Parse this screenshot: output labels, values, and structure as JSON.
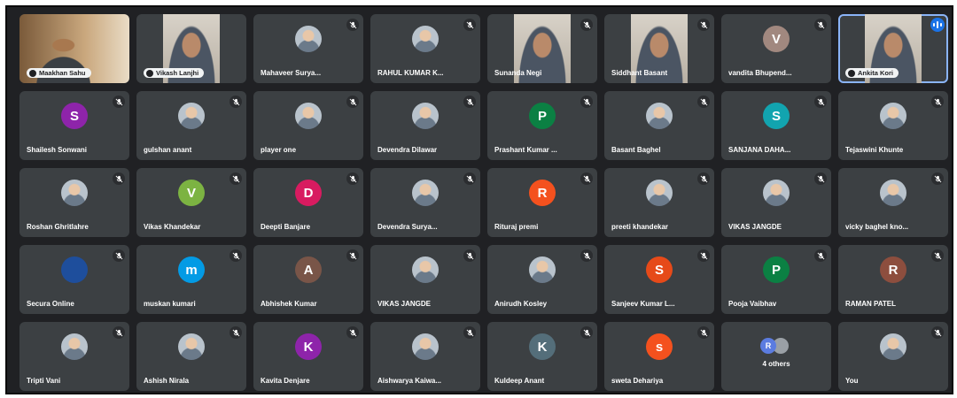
{
  "participants": [
    {
      "name": "Maakhan Sahu",
      "type": "video_wide",
      "muted": false,
      "pill": true
    },
    {
      "name": "Vikash Lanjhi",
      "type": "video",
      "muted": false,
      "pill": true
    },
    {
      "name": "Mahaveer Surya...",
      "type": "photo",
      "muted": true
    },
    {
      "name": "RAHUL KUMAR K...",
      "type": "photo",
      "muted": true
    },
    {
      "name": "Sunanda Negi",
      "type": "video",
      "muted": true
    },
    {
      "name": "Siddhant Basant",
      "type": "video",
      "muted": true
    },
    {
      "name": "vandita Bhupend...",
      "type": "letter",
      "letter": "V",
      "color": "#a1887f",
      "muted": true
    },
    {
      "name": "Ankita Kori",
      "type": "video",
      "muted": false,
      "pill": true,
      "speaking": true
    },
    {
      "name": "Shailesh Sonwani",
      "type": "letter",
      "letter": "S",
      "color": "#8e24aa",
      "muted": true
    },
    {
      "name": "gulshan anant",
      "type": "photo",
      "muted": true
    },
    {
      "name": "player one",
      "type": "photo",
      "muted": true
    },
    {
      "name": "Devendra Dilawar",
      "type": "photo",
      "muted": true
    },
    {
      "name": "Prashant Kumar ...",
      "type": "letter",
      "letter": "P",
      "color": "#0b8043",
      "muted": true
    },
    {
      "name": "Basant Baghel",
      "type": "photo",
      "muted": true
    },
    {
      "name": "SANJANA DAHA...",
      "type": "letter",
      "letter": "S",
      "color": "#12a4af",
      "muted": true
    },
    {
      "name": "Tejaswini Khunte",
      "type": "photo",
      "muted": true
    },
    {
      "name": "Roshan Ghritlahre",
      "type": "photo",
      "muted": true
    },
    {
      "name": "Vikas Khandekar",
      "type": "letter",
      "letter": "V",
      "color": "#7cb342",
      "muted": true
    },
    {
      "name": "Deepti Banjare",
      "type": "letter",
      "letter": "D",
      "color": "#d81b60",
      "muted": true
    },
    {
      "name": "Devendra Surya...",
      "type": "photo",
      "muted": true
    },
    {
      "name": "Rituraj premi",
      "type": "letter",
      "letter": "R",
      "color": "#f4511e",
      "muted": true
    },
    {
      "name": "preeti khandekar",
      "type": "photo",
      "muted": true
    },
    {
      "name": "VIKAS JANGDE",
      "type": "photo",
      "muted": true
    },
    {
      "name": "vicky baghel kno...",
      "type": "photo",
      "muted": true
    },
    {
      "name": "Secura Online",
      "type": "letter",
      "letter": "",
      "color": "#1e4e9c",
      "muted": true
    },
    {
      "name": "muskan kumari",
      "type": "letter",
      "letter": "m",
      "color": "#039be5",
      "muted": true
    },
    {
      "name": "Abhishek Kumar",
      "type": "letter",
      "letter": "A",
      "color": "#795548",
      "muted": true
    },
    {
      "name": "VIKAS JANGDE",
      "type": "photo",
      "muted": true
    },
    {
      "name": "Anirudh Kosley",
      "type": "photo",
      "muted": true
    },
    {
      "name": "Sanjeev Kumar L...",
      "type": "letter",
      "letter": "S",
      "color": "#e64a19",
      "muted": true
    },
    {
      "name": "Pooja Vaibhav",
      "type": "letter",
      "letter": "P",
      "color": "#0b8043",
      "muted": true
    },
    {
      "name": "RAMAN PATEL",
      "type": "letter",
      "letter": "R",
      "color": "#8d4e3e",
      "muted": true
    },
    {
      "name": "Tripti Vani",
      "type": "photo",
      "muted": true
    },
    {
      "name": "Ashish Nirala",
      "type": "photo",
      "muted": true
    },
    {
      "name": "Kavita Denjare",
      "type": "letter",
      "letter": "K",
      "color": "#8e24aa",
      "muted": true
    },
    {
      "name": "Aishwarya Kaiwa...",
      "type": "photo",
      "muted": true
    },
    {
      "name": "Kuldeep Anant",
      "type": "letter",
      "letter": "K",
      "color": "#546e7a",
      "muted": true
    },
    {
      "name": "sweta Dehariya",
      "type": "letter",
      "letter": "s",
      "color": "#f4511e",
      "muted": true
    },
    {
      "name": "4 others",
      "type": "others",
      "letter": "R",
      "muted": false
    },
    {
      "name": "You",
      "type": "photo",
      "muted": true
    }
  ]
}
